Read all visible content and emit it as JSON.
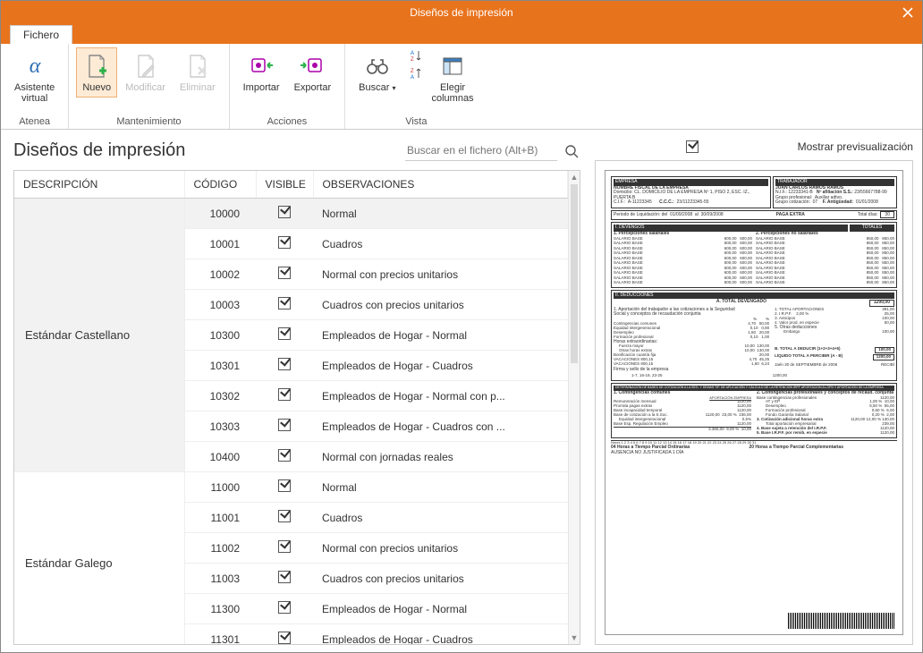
{
  "window": {
    "title": "Diseños de impresión"
  },
  "tabs": {
    "file": "Fichero"
  },
  "ribbon": {
    "groups": [
      {
        "label": "Atenea",
        "buttons": [
          {
            "key": "asistente",
            "label": "Asistente\nvirtual"
          }
        ]
      },
      {
        "label": "Mantenimiento",
        "buttons": [
          {
            "key": "nuevo",
            "label": "Nuevo"
          },
          {
            "key": "modificar",
            "label": "Modificar"
          },
          {
            "key": "eliminar",
            "label": "Eliminar"
          }
        ]
      },
      {
        "label": "Acciones",
        "buttons": [
          {
            "key": "importar",
            "label": "Importar"
          },
          {
            "key": "exportar",
            "label": "Exportar"
          }
        ]
      },
      {
        "label": "Vista",
        "buttons": [
          {
            "key": "buscar",
            "label": "Buscar"
          },
          {
            "key": "columnas",
            "label": "Elegir\ncolumnas"
          }
        ]
      }
    ]
  },
  "page": {
    "title": "Diseños de impresión",
    "search_placeholder": "Buscar en el fichero (Alt+B)"
  },
  "grid": {
    "columns": {
      "desc": "DESCRIPCIÓN",
      "codigo": "CÓDIGO",
      "visible": "VISIBLE",
      "obs": "OBSERVACIONES"
    },
    "groups": [
      {
        "desc": "Estándar Castellano",
        "rows": [
          {
            "codigo": "10000",
            "visible": true,
            "obs": "Normal",
            "selected": true
          },
          {
            "codigo": "10001",
            "visible": true,
            "obs": "Cuadros"
          },
          {
            "codigo": "10002",
            "visible": true,
            "obs": "Normal con precios unitarios"
          },
          {
            "codigo": "10003",
            "visible": true,
            "obs": "Cuadros con precios unitarios"
          },
          {
            "codigo": "10300",
            "visible": true,
            "obs": "Empleados de Hogar - Normal"
          },
          {
            "codigo": "10301",
            "visible": true,
            "obs": "Empleados de Hogar - Cuadros"
          },
          {
            "codigo": "10302",
            "visible": true,
            "obs": "Empleados de Hogar - Normal con p..."
          },
          {
            "codigo": "10303",
            "visible": true,
            "obs": "Empleados de Hogar - Cuadros con ..."
          },
          {
            "codigo": "10400",
            "visible": true,
            "obs": "Normal con jornadas reales"
          }
        ]
      },
      {
        "desc": "Estándar Galego",
        "rows": [
          {
            "codigo": "11000",
            "visible": true,
            "obs": "Normal"
          },
          {
            "codigo": "11001",
            "visible": true,
            "obs": "Cuadros"
          },
          {
            "codigo": "11002",
            "visible": true,
            "obs": "Normal con precios unitarios"
          },
          {
            "codigo": "11003",
            "visible": true,
            "obs": "Cuadros con precios unitarios"
          },
          {
            "codigo": "11300",
            "visible": true,
            "obs": "Empleados de Hogar - Normal"
          },
          {
            "codigo": "11301",
            "visible": true,
            "obs": "Empleados de Hogar - Cuadros"
          }
        ]
      }
    ]
  },
  "preview": {
    "checkbox_label": "Mostrar previsualización",
    "checked": true,
    "doc": {
      "empresa_title": "EMPRESA",
      "trabajador_title": "TRABAJADOR",
      "empresa_lines": {
        "l0": "NOMBRE FISCAL DE LA EMPRESA",
        "domicilio_label": "Domicilio:",
        "domicilio": "CL. DOMICILIO DE LA EMPRESA Nº 1, PISO 2, ESC. IZ., PUERTA B",
        "cif_label": "C.I.F.:",
        "cif": "A-11223345",
        "ccc_label": "C.C.C.:",
        "ccc": "23/11223345-55"
      },
      "trabajador_lines": {
        "nombre": "JUAN CARLOS RAMOS RAMOS",
        "nif_label": "N.I.F.:",
        "nif": "12233341-B",
        "afil_label": "Nº afiliación S.S.:",
        "afil": "23/55667788-99",
        "grupo_prof_label": "Grupo profesional:",
        "grupo_prof": "Auxiliar adtvo.",
        "grupo_cot_label": "Grupo cotización:",
        "grupo_cot": "07",
        "antig_label": "F. Antigüedad:",
        "antig": "01/01/2008"
      },
      "periodo_label": "Periodo de Liquidación: del",
      "periodo_from": "01/09/2008",
      "periodo_to_label": "al",
      "periodo_to": "30/09/2008",
      "paga_extra": "PAGA EXTRA",
      "total_dias_label": "Total días:",
      "total_dias": "30",
      "devengos_title": "I. DEVENGOS",
      "totales_title": "TOTALES",
      "percep_sal": "1. Percepciones salariales",
      "percep_nosal": "2. Percepciones no salariales",
      "salario_base": "SALARIO BASE",
      "deducciones_title": "II. DEDUCCIONES",
      "total_devengado": "A. TOTAL DEVENGADO",
      "total_devengado_val": "1200,00",
      "aport_label": "1. Aportación del trabajador a las cotizaciones a la Seguridad",
      "aport_sub": "Social y conceptos de recaudación conjunta",
      "aport2": "1.   TOTAL APORTACIONES",
      "aport2_val": "391,00",
      "irpf": "2.   I.R.P.F.",
      "irpf_pct": "2,00   %",
      "irpf_val": "25,00",
      "anticipos": "3.   Anticipos",
      "anticipos_val": "100,00",
      "valorprod": "4.   Valor prod. en especie",
      "valorprod_val": "50,00",
      "otras": "5.   Otras deducciones",
      "embargo": "Embargo",
      "embargo_val": "100,00",
      "cont_comunes": "Contingencias comunes",
      "cont_comunes_v1": "4,70",
      "cont_comunes_v2": "50,00",
      "equidad": "Equidad intergeneracional",
      "equidad_v1": "0,10",
      "equidad_v2": "0,80",
      "desempleo": "Desempleo",
      "desempleo_v1": "1,60",
      "desempleo_v2": "20,00",
      "fprof": "Formación profesional",
      "fprof_v1": "0,10",
      "fprof_v2": "1,00",
      "horas_ext": "Horas extraordinarias:",
      "fuerza_mayor": "Fuerza mayor",
      "fuerza_mayor_v1": "10,00",
      "fuerza_mayor_v2": "130,00",
      "otras_horas": "Otras horas extras",
      "otras_horas_v1": "10,00",
      "otras_horas_v2": "130,00",
      "bonif": "Bonificación cuantía fija",
      "bonif_v": "20,00",
      "vac1": "VACACIONES   800,15",
      "vac1_v1": "4,70",
      "vac1_v2": "45,25",
      "vac2": "VACACIONES   800,15",
      "vac2_v1": "1,60",
      "vac2_v2": "6,24",
      "total_deducir": "B. TOTAL A DEDUCIR (1+2+3+4+5)",
      "total_deducir_val": "100,00",
      "liquido": "LÍQUIDO TOTAL A PERCIBIR (A - B)",
      "liquido_val": "1200,00",
      "firma": "Firma y sello de la empresa",
      "fecha": "Jaén 30   de SEPTIEMBRE   de   2008",
      "recibi": "RECIBÍ",
      "tramo": "1-7, 16-19, 23-25",
      "tramo_val": "1200,00",
      "det_title": "DETERMINACIÓN DE BASES DE COTIZACIÓN A LA SEG. Y DEMÁS TIP. DE APLICACIÓN Y CÁLCULO DE LA RETENCIÓN IRPF APORTACIÓN A LOPD Y APORTACIÓN DE LA EMPRESA",
      "cc_title": "1. Contingencias comunes",
      "cp_title": "2. Contingencias profesionales y conceptos de recaud. conjunta",
      "aport_empresa": "APORTACIÓN EMPRESA",
      "rem_mensual": "Remuneración mensual",
      "rem_mensual_v": "1120,00",
      "prorrata": "Prorrata pagas extras",
      "prorrata_v": "1120,00",
      "base_it": "Base incapacidad temporal",
      "base_it_v": "1120,00",
      "base_ss": "Base de cotización a la S.Soc.",
      "base_ss_v": "1120,00",
      "base_ss_p": "23,00  %",
      "base_ss_a": "236,00",
      "equidad2": "Equidad intergeneracional",
      "equidad2_p": "0,5%",
      "base_emp": "Base Esp. Regulación Empleo",
      "base_emp_v": "1120,00",
      "sum": "3.360,00",
      "sum_p": "9,00 %",
      "sum_a": "10,00",
      "base_cp": "Base contingencias profesionales",
      "base_cp_v": "1120,00",
      "at_ep": "AT y EP",
      "at_ep_p": "1,00  %",
      "at_ep_a": "10,00",
      "desempleo2": "Desempleo",
      "desempleo2_p": "5,50  %",
      "desempleo2_a": "55,00",
      "fprof2": "Formación profesional",
      "fprof2_p": "0,60  %",
      "fprof2_a": "6,00",
      "fgs": "Fondo Garantía Salarial",
      "fgs_p": "0,20  %",
      "fgs_a": "2,00",
      "cot_ad": "3. Cotización adicional horas extra",
      "cot_ad_v": "1120,00",
      "cot_ad_p": "12,00  %",
      "cot_ad_a": "130,00",
      "tot_ap_emp": "Total aportación empresarial",
      "tot_ap_emp_v": "239,00",
      "base_irpf": "4. Base sujeta a retención del I.R.P.F.",
      "base_irpf_v": "1120,00",
      "base_irpf2": "5. Base I.R.P.F. por remib. en especie",
      "base_irpf2_v": "1120,00",
      "footer_left": "04 Horas a Tiempo Parcial Ordinarias",
      "footer_sub": "AUSENCIA NO JUSTIFICADA 1 DÍA",
      "footer_right": "20 Horas a Tiempo Parcial Complementarias",
      "sal_val1": "600,00",
      "sal_val2": "850,00"
    }
  }
}
